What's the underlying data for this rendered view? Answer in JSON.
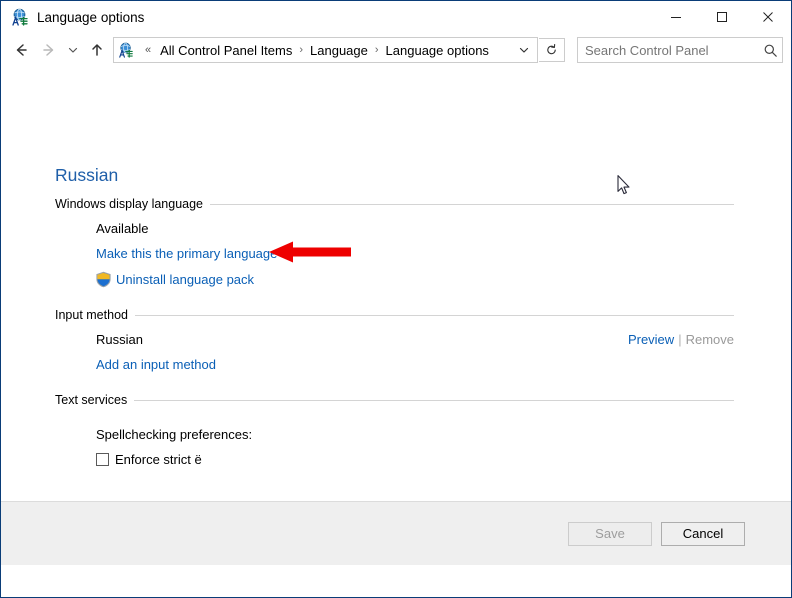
{
  "window": {
    "title": "Language options",
    "app_icon": "language-globe-icon",
    "border_color": "#0a3d78",
    "controls": {
      "minimize": "minimize-icon",
      "maximize": "maximize-icon",
      "close": "close-icon"
    }
  },
  "navbar": {
    "back": "back-arrow-icon",
    "forward": "forward-arrow-icon",
    "recent": "chevron-down-icon",
    "up": "up-arrow-icon",
    "address_icon": "language-globe-icon",
    "overflow": "«",
    "breadcrumbs": [
      {
        "label": "All Control Panel Items"
      },
      {
        "label": "Language"
      },
      {
        "label": "Language options"
      }
    ],
    "separator": "›",
    "dropdown": "chevron-down-icon",
    "refresh": "refresh-icon"
  },
  "search": {
    "placeholder": "Search Control Panel",
    "value": "",
    "icon": "search-icon"
  },
  "page": {
    "title": "Russian"
  },
  "sections": {
    "display_language": {
      "label": "Windows display language",
      "status": "Available",
      "primary_link": "Make this the primary language",
      "uninstall_link": "Uninstall language pack",
      "uninstall_icon": "uac-shield-icon"
    },
    "input_method": {
      "label": "Input method",
      "name": "Russian",
      "preview_link": "Preview",
      "separator": "|",
      "remove_link": "Remove",
      "remove_enabled": false,
      "add_link": "Add an input method"
    },
    "text_services": {
      "label": "Text services",
      "spellcheck_label": "Spellchecking preferences:",
      "checkbox_label": "Enforce strict ë",
      "checkbox_checked": false
    }
  },
  "annotation": {
    "arrow": "red-arrow-pointer",
    "color": "#ee0000"
  },
  "cursor": {
    "icon": "mouse-pointer-icon"
  },
  "footer": {
    "save_label": "Save",
    "save_enabled": false,
    "cancel_label": "Cancel"
  },
  "colors": {
    "link": "#0a5fb6",
    "title": "#1f5fa9",
    "disabled": "#9a9a9a",
    "accent": "#0a3d78"
  }
}
